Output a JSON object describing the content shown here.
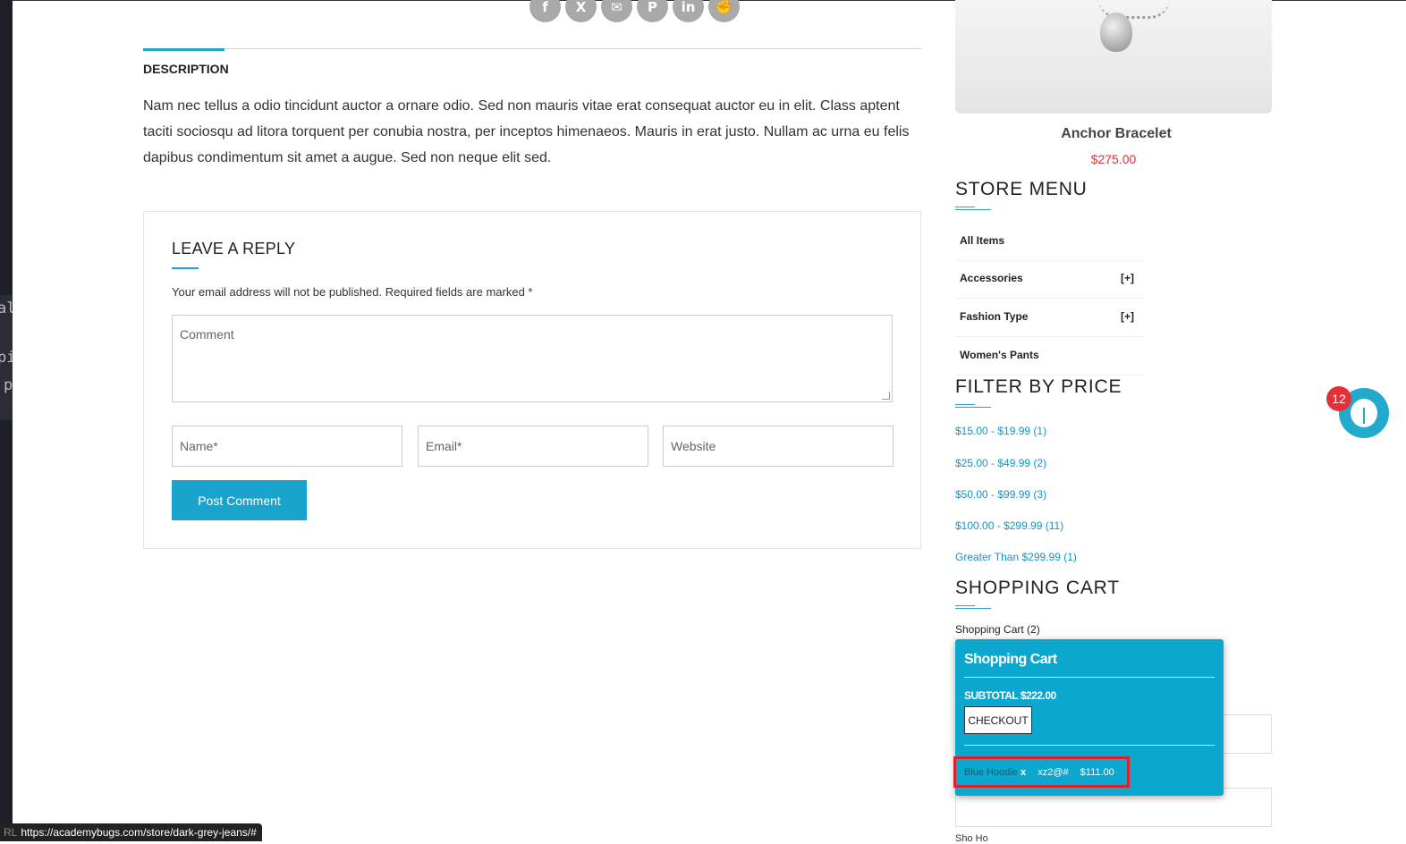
{
  "description": {
    "tab_label": "DESCRIPTION",
    "text": "Nam nec tellus a odio tincidunt auctor a ornare odio. Sed non mauris vitae erat consequat auctor eu in elit. Class aptent taciti sociosqu ad litora torquent per conubia nostra, per inceptos himenaeos. Mauris in erat justo. Nullam ac urna eu felis dapibus condimentum sit amet a augue. Sed non neque elit sed."
  },
  "share_icons": [
    "facebook-icon",
    "x-twitter-icon",
    "email-icon",
    "pinterest-icon",
    "linkedin-icon",
    "stumbleupon-icon"
  ],
  "reply": {
    "title": "LEAVE A REPLY",
    "note": "Your email address will not be published. Required fields are marked *",
    "comment_placeholder": "Comment",
    "name_placeholder": "Name*",
    "email_placeholder": "Email*",
    "website_placeholder": "Website",
    "post_label": "Post Comment"
  },
  "product": {
    "name": "Anchor Bracelet",
    "price": "$275.00"
  },
  "store_menu": {
    "title": "STORE MENU",
    "items": [
      {
        "label": "All Items",
        "toggle": ""
      },
      {
        "label": "Accessories",
        "toggle": "[+]"
      },
      {
        "label": "Fashion Type",
        "toggle": "[+]"
      },
      {
        "label": "Women's Pants",
        "toggle": ""
      }
    ]
  },
  "filter": {
    "title": "FILTER BY PRICE",
    "ranges": [
      "$15.00 - $19.99 (1)",
      "$25.00 - $49.99 (2)",
      "$50.00 - $99.99 (3)",
      "$100.00 - $299.99 (11)",
      "Greater Than $299.99 (1)"
    ]
  },
  "cart": {
    "title": "SHOPPING CART",
    "count_label": "Shopping Cart (2)",
    "popup_title": "Shopping Cart",
    "subtotal": "SUBTOTAL $222.00",
    "checkout_label": "CHECKOUT",
    "item_name": "Blue Hoodie",
    "item_qty": "x",
    "item_code": "xz2@#",
    "item_price": "$111.00"
  },
  "bug_widget": {
    "count": "12"
  },
  "status_bar": {
    "prefix": "RL",
    "url": "https://academybugs.com/store/dark-grey-jeans/#"
  },
  "left_strip_glyphs": [
    "al",
    "pi",
    "p"
  ],
  "partial_label": "Sho Ho",
  "colors": {
    "accent": "#18a4cd",
    "price": "#e22f3a",
    "highlight": "#e31e2b"
  }
}
